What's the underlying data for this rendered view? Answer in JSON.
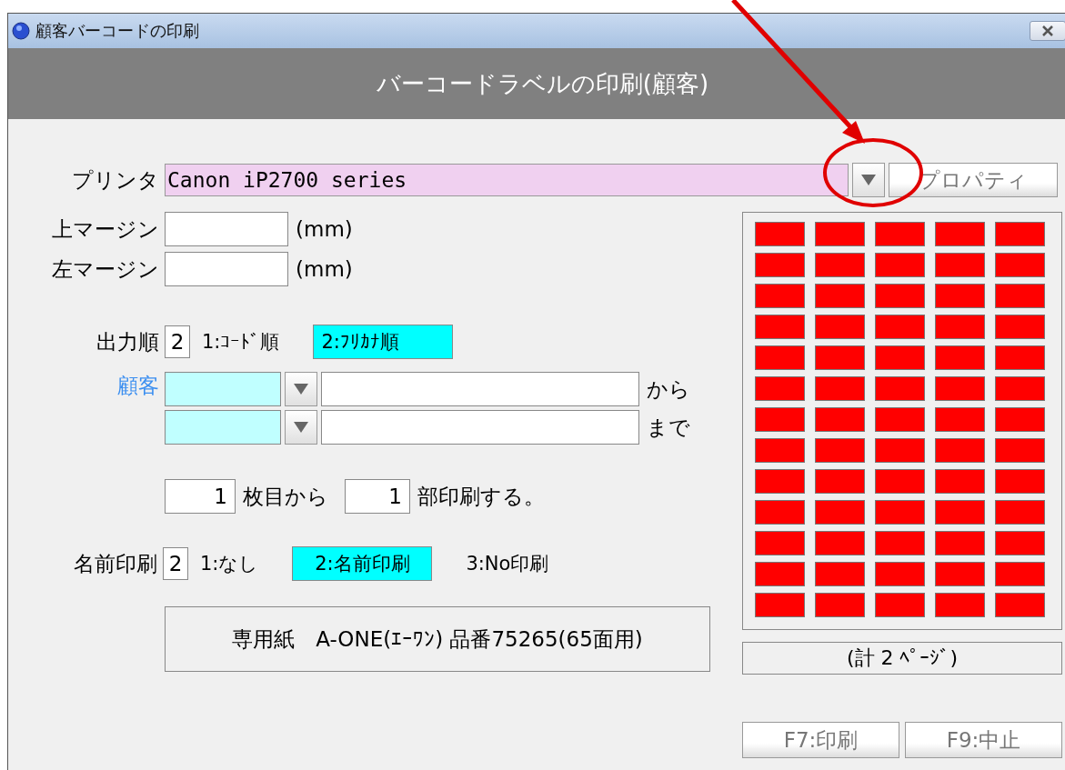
{
  "window": {
    "title": "顧客バーコードの印刷"
  },
  "header": "バーコードラベルの印刷(顧客)",
  "printer": {
    "label": "プリンタ",
    "value": "Canon iP2700 series",
    "properties_button": "プロパティ"
  },
  "margins": [
    {
      "label": "上マージン",
      "unit": "(mm)"
    },
    {
      "label": "左マージン",
      "unit": "(mm)"
    }
  ],
  "output_order": {
    "label": "出力順",
    "value": "2",
    "options": [
      {
        "text": "1:ｺｰﾄﾞ順",
        "selected": false
      },
      {
        "text": "2:ﾌﾘｶﾅ順",
        "selected": true
      }
    ]
  },
  "customer": {
    "label": "顧客",
    "rows": [
      {
        "suffix": "から"
      },
      {
        "suffix": "まで"
      }
    ]
  },
  "copies": {
    "start_value": "1",
    "start_text": "枚目から",
    "count_value": "1",
    "count_text": "部印刷する。"
  },
  "name_print": {
    "label": "名前印刷",
    "value": "2",
    "options": [
      {
        "text": "1:なし",
        "selected": false
      },
      {
        "text": "2:名前印刷",
        "selected": true
      },
      {
        "text": "3:No印刷",
        "selected": false
      }
    ]
  },
  "paper_note": "専用紙　A-ONE(ｴｰﾜﾝ) 品番75265(65面用)",
  "page_total": "(計 2 ﾍﾟｰｼﾞ)",
  "buttons": [
    "F7:印刷",
    "F9:中止"
  ]
}
